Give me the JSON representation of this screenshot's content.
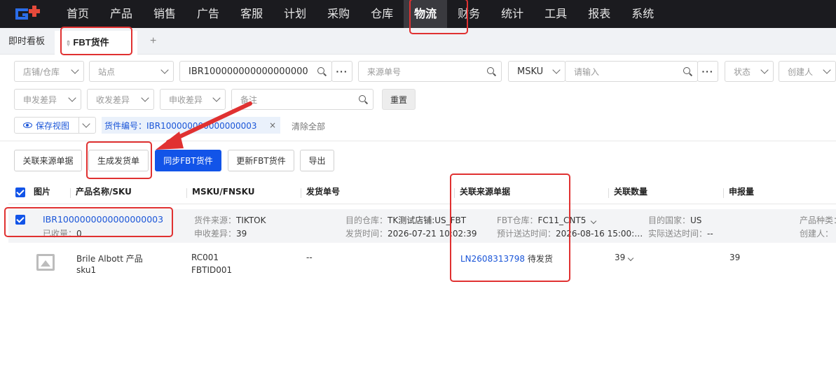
{
  "nav": {
    "items": [
      "首页",
      "产品",
      "销售",
      "广告",
      "客服",
      "计划",
      "采购",
      "仓库",
      "物流",
      "财务",
      "统计",
      "工具",
      "报表",
      "系统"
    ],
    "active_index": 8
  },
  "tabs": {
    "dashboard": "即时看板",
    "active": "FBT货件",
    "add": "+"
  },
  "filters": {
    "shop_warehouse": "店铺/仓库",
    "site": "站点",
    "shipment_no": "IBR100000000000000000",
    "source_no": "来源单号",
    "msku": "MSKU",
    "msku_input": "请输入",
    "status": "状态",
    "creator": "创建人",
    "ship_diff": "申发差异",
    "recv_diff": "收发差异",
    "apply_recv_diff": "申收差异",
    "remark": "备注",
    "reset": "重置",
    "more": "···"
  },
  "view": {
    "save_view": "保存视图",
    "chip": "货件编号：IBR100000000000000003",
    "chip_close": "×",
    "clear_all": "清除全部"
  },
  "actions": {
    "link_source": "关联来源单据",
    "gen_delivery": "生成发货单",
    "sync_fbt": "同步FBT货件",
    "update_fbt": "更新FBT货件",
    "export": "导出"
  },
  "table": {
    "headers": [
      "图片",
      "产品名称/SKU",
      "MSKU/FNSKU",
      "发货单号",
      "关联来源单据",
      "关联数量",
      "申报量"
    ],
    "group": {
      "shipment_id": "IBR1000000000000000003",
      "received_label": "已收量：",
      "received": "0",
      "source_label": "货件来源：",
      "source": "TIKTOK",
      "apply_diff_label": "申收差异：",
      "apply_diff": "39",
      "dest_wh_label": "目的仓库：",
      "dest_wh": "TK测试店铺:US_FBT",
      "ship_time_label": "发货时间：",
      "ship_time": "2026-07-21 10:02:39",
      "fbt_wh_label": "FBT仓库：",
      "fbt_wh": "FC11_CNT5",
      "eta_label": "预计送达时间：",
      "eta": "2026-08-16 15:00:…",
      "dest_country_label": "目的国家：",
      "dest_country": "US",
      "actual_label": "实际送达时间：",
      "actual": "--",
      "product_type_label": "产品种类：",
      "creator_label": "创建人："
    },
    "row": {
      "product_name": "Brile Albott 产品",
      "sku": "sku1",
      "msku": "RC001",
      "fnsku": "FBTID001",
      "delivery_no": "--",
      "source_doc": "LN2608313798",
      "source_status": "待发货",
      "linked_qty": "39",
      "declared_qty": "39"
    }
  },
  "colors": {
    "accent": "#1254e8",
    "link": "#1a55d8",
    "annotation": "#e03131",
    "nav_bg": "#1b1b1f"
  }
}
